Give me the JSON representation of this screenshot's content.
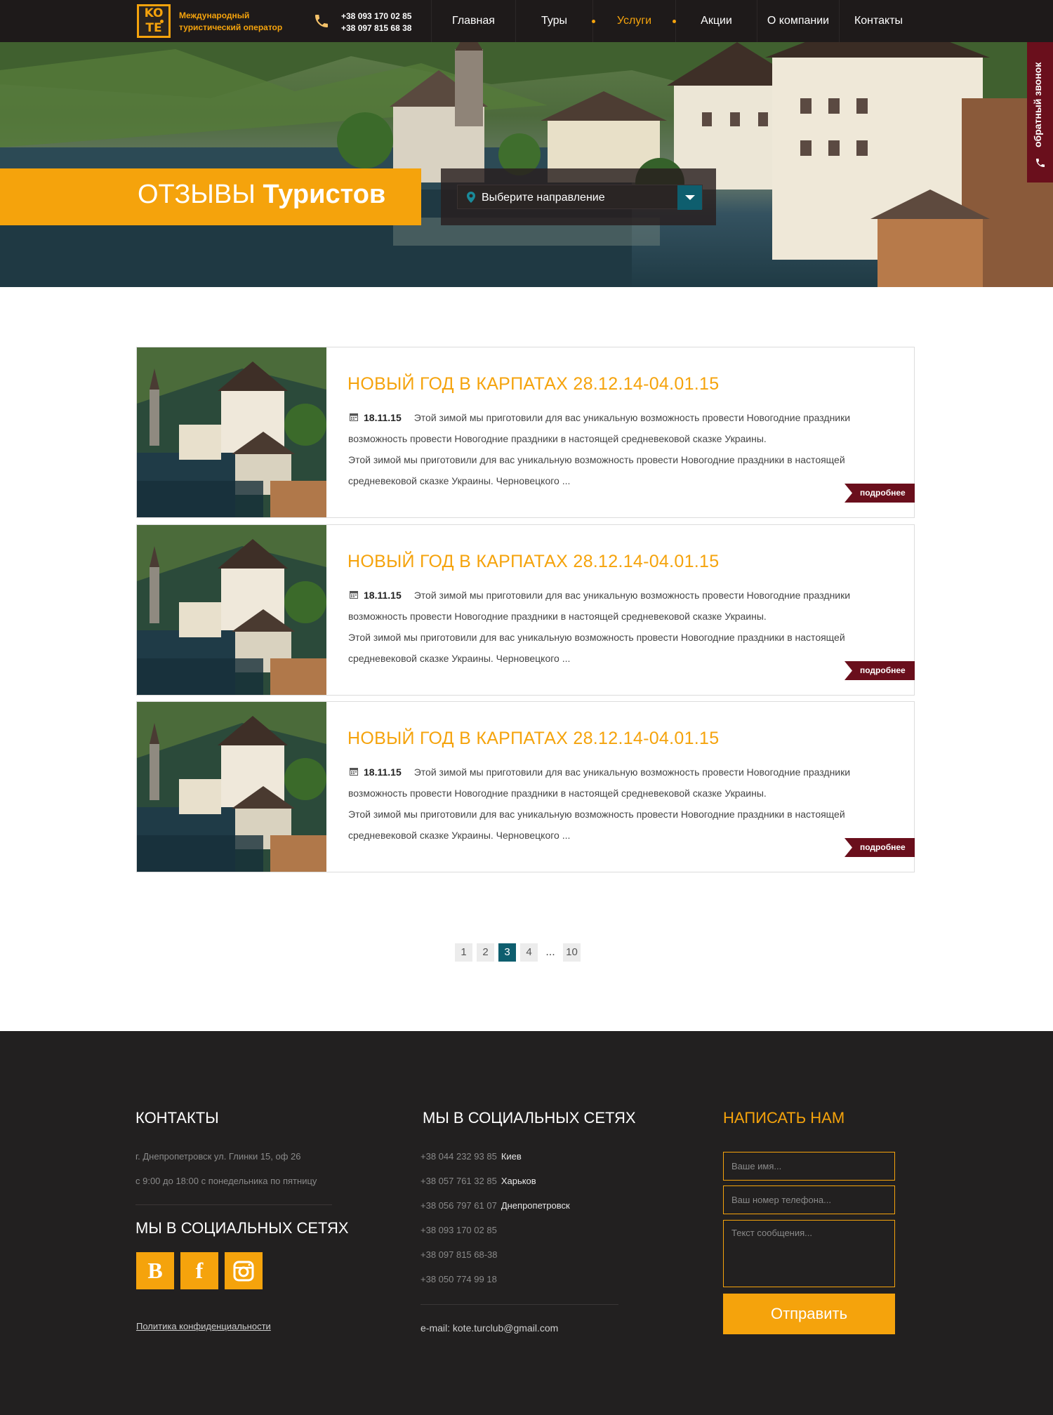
{
  "header": {
    "logo_letters": [
      "KO",
      "TE"
    ],
    "tagline_line1": "Международный",
    "tagline_line2": "туристический оператор",
    "phone1": "+38 093 170 02 85",
    "phone2": "+38 097 815 68 38",
    "nav": [
      {
        "label": "Главная"
      },
      {
        "label": "Туры"
      },
      {
        "label": "Услуги",
        "active": true
      },
      {
        "label": "Акции"
      },
      {
        "label": "О компании"
      },
      {
        "label": "Контакты"
      }
    ]
  },
  "hero": {
    "title_light": "ОТЗЫВЫ",
    "title_bold": "Туристов",
    "destination_placeholder": "Выберите направление",
    "callback_label": "обратный звонок"
  },
  "news": [
    {
      "title": "НОВЫЙ ГОД В КАРПАТАХ 28.12.14-04.01.15",
      "date": "18.11.15",
      "text_lead": "Этой зимой мы приготовили для вас уникальную возможность провести Новогодние праздники возможность провести Новогодние праздники в настоящей средневековой сказке Украины.",
      "text_body": "Этой зимой мы приготовили для вас уникальную возможность провести Новогодние праздники в настоящей средневековой сказке Украины. Черновецкого  ...",
      "more_label": "подробнее"
    },
    {
      "title": "НОВЫЙ ГОД В КАРПАТАХ 28.12.14-04.01.15",
      "date": "18.11.15",
      "text_lead": "Этой зимой мы приготовили для вас уникальную возможность провести Новогодние праздники возможность провести Новогодние праздники в настоящей средневековой сказке Украины.",
      "text_body": "Этой зимой мы приготовили для вас уникальную возможность провести Новогодние праздники в настоящей средневековой сказке Украины. Черновецкого  ...",
      "more_label": "подробнее"
    },
    {
      "title": "НОВЫЙ ГОД В КАРПАТАХ 28.12.14-04.01.15",
      "date": "18.11.15",
      "text_lead": "Этой зимой мы приготовили для вас уникальную возможность провести Новогодние праздники возможность провести Новогодние праздники в настоящей средневековой сказке Украины.",
      "text_body": "Этой зимой мы приготовили для вас уникальную возможность провести Новогодние праздники в настоящей средневековой сказке Украины. Черновецкого  ...",
      "more_label": "подробнее"
    }
  ],
  "pagination": {
    "pages": [
      "1",
      "2",
      "3",
      "4"
    ],
    "current": "3",
    "ellipsis": "...",
    "last": "10"
  },
  "footer": {
    "contacts_heading": "КОНТАКТЫ",
    "address": "г. Днепропетровск ул. Глинки 15, оф 26",
    "hours": "с 9:00 до 18:00 с понедельника по пятницу",
    "social_heading_left": "МЫ В СОЦИАЛЬНЫХ СЕТЯХ",
    "social_icons": [
      "vk-icon",
      "facebook-icon",
      "instagram-icon"
    ],
    "social_letters": [
      "В",
      "f",
      "◙"
    ],
    "privacy": "Политика конфиденциальности",
    "social_heading_mid": "МЫ В СОЦИАЛЬНЫХ СЕТЯХ",
    "phones": [
      {
        "number": "+38 044 232 93 85",
        "city": "Киев"
      },
      {
        "number": "+38 057 761 32 85",
        "city": "Харьков"
      },
      {
        "number": "+38 056 797 61 07",
        "city": "Днепропетровск"
      },
      {
        "number": "+38 093 170 02 85",
        "city": ""
      },
      {
        "number": "+38 097 815 68-38",
        "city": ""
      },
      {
        "number": "+38 050 774 99 18",
        "city": ""
      }
    ],
    "email": "e-mail: kote.turclub@gmail.com",
    "write_heading": "НАПИСАТЬ НАМ",
    "name_placeholder": "Ваше имя...",
    "phone_placeholder": "Ваш номер телефона...",
    "message_placeholder": "Текст сообщения...",
    "send_label": "Отправить"
  },
  "colors": {
    "accent": "#f5a30c",
    "dark": "#1e1a1a",
    "burgundy": "#6a0f1c",
    "teal": "#0e5e6e",
    "footer_bg": "#222020"
  }
}
